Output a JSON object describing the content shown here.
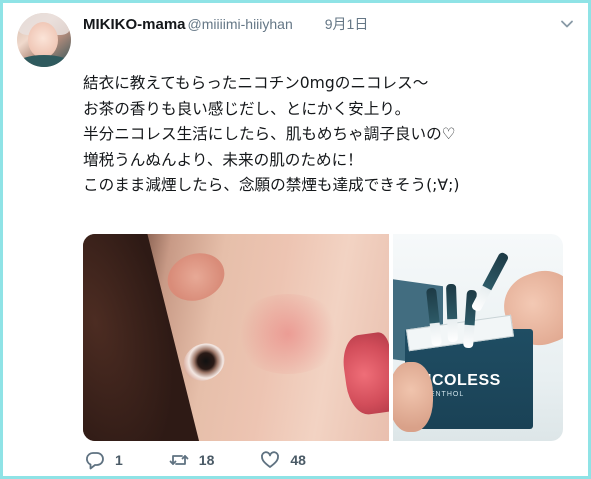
{
  "tweet": {
    "name": "MIKIKO-mama",
    "handle": "@miiiimi-hiiiyhan",
    "date": "9月1日",
    "lines": [
      "結衣に教えてもらったニコチン0mgのニコレス〜",
      "お茶の香りも良い感じだし、とにかく安上り。",
      "半分ニコレス生活にしたら、肌もめちゃ調子良いの♡",
      "増税うんぬんより、未来の肌のために！",
      "このまま減煙したら、念願の禁煙も達成できそう(;∀;)"
    ],
    "product_brand": "NICOLESS",
    "product_sub": "MENTHOL",
    "replies": "1",
    "retweets": "18",
    "likes": "48"
  },
  "colors": {
    "frame": "#8fe3e6",
    "text": "#14171a",
    "muted": "#657786"
  },
  "icons": [
    "chevron-down-icon",
    "reply-icon",
    "retweet-icon",
    "heart-icon"
  ]
}
